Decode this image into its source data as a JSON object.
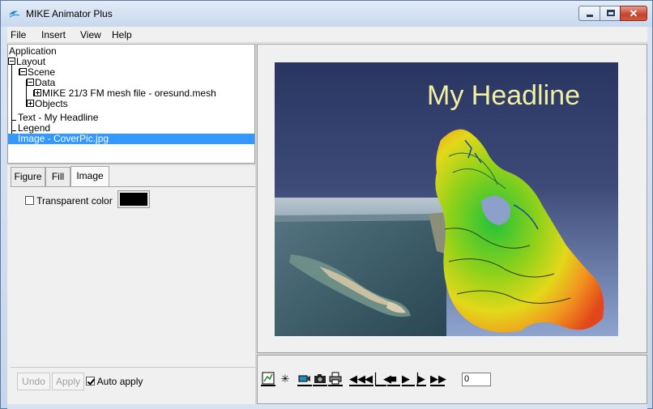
{
  "window": {
    "title": "MIKE Animator Plus"
  },
  "menu": [
    "File",
    "Insert",
    "View",
    "Help"
  ],
  "tree": {
    "items": [
      "Application",
      "Layout",
      "Scene",
      "Data",
      "MIKE 21/3 FM mesh file - oresund.mesh",
      "Objects",
      "Text - My Headline",
      "Legend",
      "Image - CoverPic.jpg"
    ],
    "selected": "Image - CoverPic.jpg"
  },
  "tabs": [
    "Figure",
    "Fill",
    "Image"
  ],
  "active_tab": "Image",
  "image_tab": {
    "transparent_label": "Transparent color",
    "transparent_checked": false,
    "color": "#000000"
  },
  "footer": {
    "undo": "Undo",
    "apply": "Apply",
    "auto_apply": "Auto apply",
    "auto_apply_checked": true
  },
  "viewport": {
    "headline": "My Headline"
  },
  "playback": {
    "frame": "0"
  },
  "colors": {
    "selection": "#3399ff",
    "headline": "#f1f0a0"
  },
  "icons": [
    "chart-icon",
    "asterisk-icon",
    "video-icon",
    "camera-icon",
    "printer-icon",
    "rewind-icon",
    "step-back-icon",
    "to-start-icon",
    "stop-icon",
    "to-end-icon",
    "play-icon",
    "fast-forward-icon"
  ]
}
